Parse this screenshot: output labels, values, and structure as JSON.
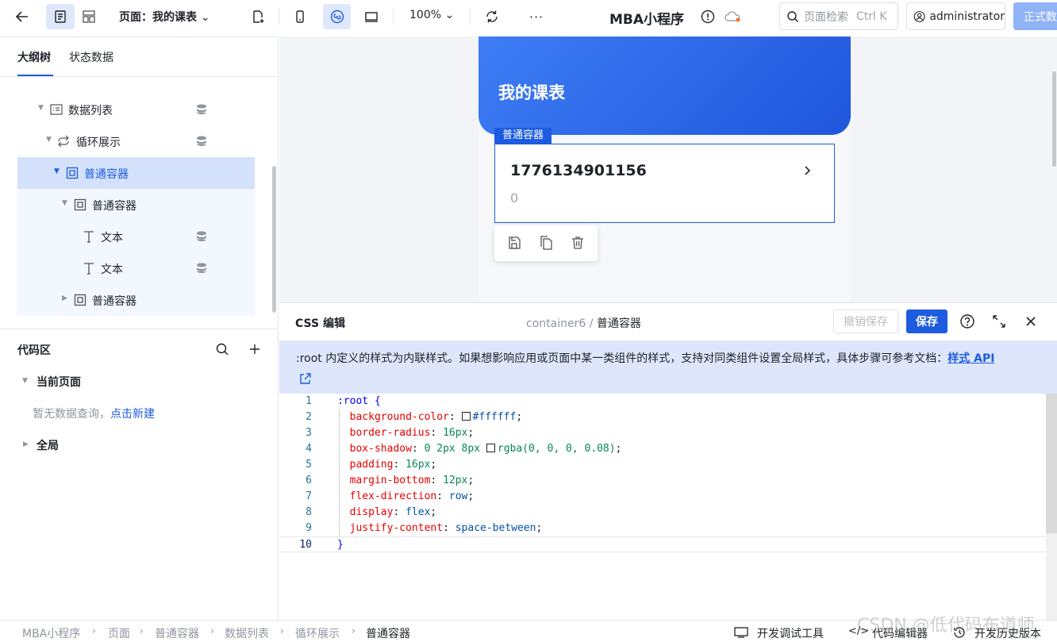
{
  "topbar": {
    "page_select_label": "页面：我的课表",
    "zoom": "100%",
    "app_name": "MBA小程序",
    "search_placeholder": "页面检索",
    "search_shortcut": "Ctrl K",
    "user": "administrator",
    "publish": "正式数"
  },
  "left_panel": {
    "tabs": [
      "大纲树",
      "状态数据"
    ],
    "tree": [
      {
        "label": "数据列表",
        "icon": "list-icon"
      },
      {
        "label": "循环展示",
        "icon": "loop-icon"
      },
      {
        "label": "普通容器",
        "icon": "container-icon",
        "selected": true
      },
      {
        "label": "普通容器",
        "icon": "container-icon"
      },
      {
        "label": "文本",
        "icon": "text-icon"
      },
      {
        "label": "文本",
        "icon": "text-icon"
      },
      {
        "label": "普通容器",
        "icon": "container-icon"
      }
    ],
    "code_area": {
      "title": "代码区",
      "current_page": "当前页面",
      "empty_text": "暂无数据查询，",
      "create_link": "点击新建",
      "global": "全局"
    }
  },
  "canvas": {
    "page_title": "我的课表",
    "selected_tag": "普通容器",
    "card_number": "1776134901156",
    "card_sub": "0"
  },
  "css_editor": {
    "title": "CSS 编辑",
    "crumb_id": "container6",
    "crumb_sep": "/",
    "crumb_name": "普通容器",
    "cancel_save": "撤销保存",
    "save": "保存",
    "notice": ":root 内定义的样式为内联样式。如果想影响应用或页面中某一类组件的样式，支持对同类组件设置全局样式，具体步骤可参考文档：",
    "notice_link": "样式 API",
    "lines": [
      {
        "n": "1",
        "prop": ":root",
        "val": "{"
      },
      {
        "n": "2",
        "prop": "background-color",
        "val": "#ffffff",
        "swatch": "#ffffff"
      },
      {
        "n": "3",
        "prop": "border-radius",
        "val": "16px"
      },
      {
        "n": "4",
        "prop": "box-shadow",
        "val": "0 2px 8px",
        "val2": "rgba(0, 0, 0, 0.08)",
        "swatch": "#ffffff"
      },
      {
        "n": "5",
        "prop": "padding",
        "val": "16px"
      },
      {
        "n": "6",
        "prop": "margin-bottom",
        "val": "12px"
      },
      {
        "n": "7",
        "prop": "flex-direction",
        "val": "row"
      },
      {
        "n": "8",
        "prop": "display",
        "val": "flex"
      },
      {
        "n": "9",
        "prop": "justify-content",
        "val": "space-between"
      },
      {
        "n": "10",
        "prop": "",
        "val": "}"
      }
    ]
  },
  "statusbar": {
    "breadcrumbs": [
      "MBA小程序",
      "页面",
      "普通容器",
      "数据列表",
      "循环展示",
      "普通容器"
    ],
    "tools": [
      "开发调试工具",
      "代码编辑器",
      "开发历史版本"
    ]
  },
  "watermark": "CSDN @低代码布道师",
  "colors": {
    "primary": "#1d5ce0",
    "header_gradient_start": "#3f7ef5",
    "header_gradient_end": "#1f56dc"
  }
}
